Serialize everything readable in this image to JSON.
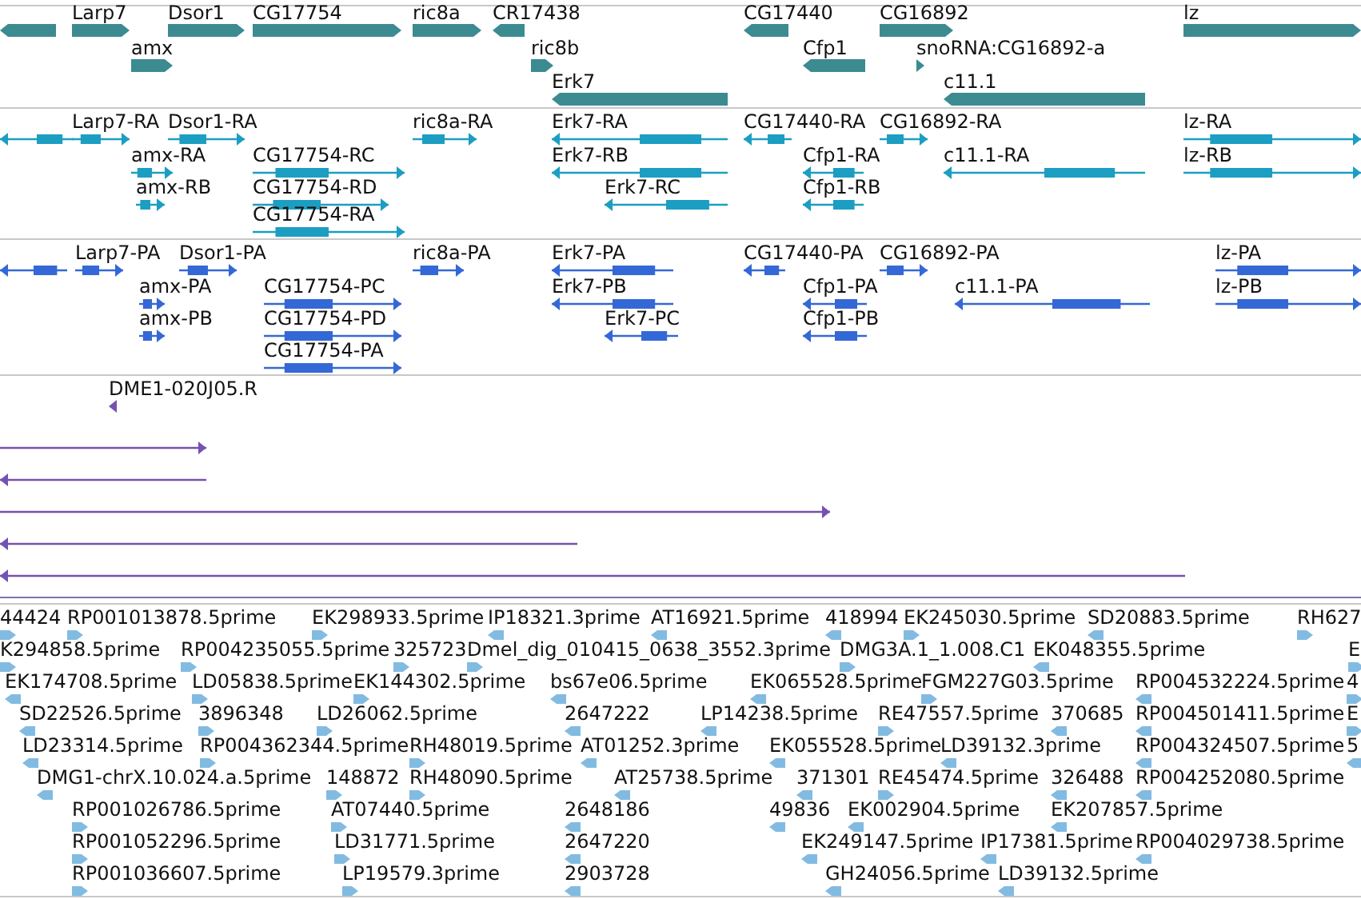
{
  "tracks": [
    {
      "kind": "gene",
      "features": [
        {
          "reverse": true
        },
        {
          "label": "Larp7",
          "reverse": false
        },
        {
          "label": "amx",
          "reverse": false
        },
        {
          "label": "Dsor1",
          "reverse": false
        },
        {
          "label": "CG17754",
          "reverse": false
        },
        {
          "label": "ric8a",
          "reverse": false
        },
        {
          "label": "CR17438",
          "reverse": true
        },
        {
          "label": "ric8b",
          "reverse": false
        },
        {
          "label": "Erk7",
          "reverse": true
        },
        {
          "label": "CG17440",
          "reverse": true
        },
        {
          "label": "Cfp1",
          "reverse": true
        },
        {
          "label": "CG16892",
          "reverse": false
        },
        {
          "label": "snoRNA:CG16892-a",
          "reverse": false
        },
        {
          "label": "c11.1",
          "reverse": true
        },
        {
          "label": "lz",
          "reverse": false
        }
      ]
    },
    {
      "kind": "transcript",
      "features": [
        {
          "reverse": true
        },
        {
          "label": "Larp7-RA",
          "reverse": false
        },
        {
          "label": "Dsor1-RA",
          "reverse": false
        },
        {
          "label": "amx-RA",
          "reverse": false
        },
        {
          "label": "amx-RB",
          "reverse": false
        },
        {
          "label": "CG17754-RC",
          "reverse": false
        },
        {
          "label": "CG17754-RD",
          "reverse": false
        },
        {
          "label": "CG17754-RA",
          "reverse": false
        },
        {
          "label": "ric8a-RA",
          "reverse": false
        },
        {
          "label": "Erk7-RA",
          "reverse": true
        },
        {
          "label": "Erk7-RB",
          "reverse": true
        },
        {
          "label": "Erk7-RC",
          "reverse": true
        },
        {
          "label": "CG17440-RA",
          "reverse": true
        },
        {
          "label": "CG16892-RA",
          "reverse": false
        },
        {
          "label": "Cfp1-RA",
          "reverse": true
        },
        {
          "label": "Cfp1-RB",
          "reverse": true
        },
        {
          "label": "c11.1-RA",
          "reverse": true
        },
        {
          "label": "lz-RA",
          "reverse": false
        },
        {
          "label": "lz-RB",
          "reverse": false
        }
      ]
    },
    {
      "kind": "polypeptide",
      "features": [
        {
          "reverse": true
        },
        {
          "label": "Larp7-PA",
          "reverse": false
        },
        {
          "label": "Dsor1-PA",
          "reverse": false
        },
        {
          "label": "amx-PA",
          "reverse": false
        },
        {
          "label": "amx-PB",
          "reverse": false
        },
        {
          "label": "CG17754-PC",
          "reverse": false
        },
        {
          "label": "CG17754-PD",
          "reverse": false
        },
        {
          "label": "CG17754-PA",
          "reverse": false
        },
        {
          "label": "ric8a-PA",
          "reverse": false
        },
        {
          "label": "Erk7-PA",
          "reverse": true
        },
        {
          "label": "Erk7-PB",
          "reverse": true
        },
        {
          "label": "Erk7-PC",
          "reverse": true
        },
        {
          "label": "CG17440-PA",
          "reverse": true
        },
        {
          "label": "CG16892-PA",
          "reverse": false
        },
        {
          "label": "Cfp1-PA",
          "reverse": true
        },
        {
          "label": "Cfp1-PB",
          "reverse": true
        },
        {
          "label": "c11.1-PA",
          "reverse": true
        },
        {
          "label": "lz-PA",
          "reverse": false
        },
        {
          "label": "lz-PB",
          "reverse": false
        }
      ]
    },
    {
      "kind": "cdna",
      "features": [
        {
          "label": "DME1-020J05.R",
          "reverse": true
        },
        {
          "reverse": false
        },
        {
          "reverse": true
        },
        {
          "reverse": false
        },
        {
          "reverse": true
        },
        {
          "reverse": true
        }
      ]
    },
    {
      "kind": "est",
      "features": [
        {
          "label": "44424",
          "reverse": false
        },
        {
          "label": "RP001013878.5prime",
          "reverse": false
        },
        {
          "label": "EK298933.5prime",
          "reverse": false
        },
        {
          "label": "IP18321.3prime",
          "reverse": true
        },
        {
          "label": "AT16921.5prime",
          "reverse": true
        },
        {
          "label": "418994",
          "reverse": true
        },
        {
          "label": "EK245030.5prime",
          "reverse": false
        },
        {
          "label": "SD20883.5prime",
          "reverse": true
        },
        {
          "label": "RH627",
          "reverse": false
        },
        {
          "label": "K294858.5prime",
          "reverse": false
        },
        {
          "label": "RP004235055.5prime",
          "reverse": false
        },
        {
          "label": "325723",
          "reverse": false
        },
        {
          "label": "Dmel_dig_010415_0638_3552.3prime",
          "reverse": false
        },
        {
          "label": "DMG3A.1_1.008.C1",
          "reverse": false
        },
        {
          "label": "EK048355.5prime",
          "reverse": true
        },
        {
          "label": "E",
          "reverse": false
        },
        {
          "label": "EK174708.5prime",
          "reverse": true
        },
        {
          "label": "LD05838.5prime",
          "reverse": false
        },
        {
          "label": "EK144302.5prime",
          "reverse": false
        },
        {
          "label": "bs67e06.5prime",
          "reverse": true
        },
        {
          "label": "EK065528.5prime",
          "reverse": true
        },
        {
          "label": "FGM227G03.5prime",
          "reverse": false
        },
        {
          "label": "RP004532224.5prime",
          "reverse": true
        },
        {
          "label": "4",
          "reverse": false
        },
        {
          "label": "SD22526.5prime",
          "reverse": true
        },
        {
          "label": "3896348",
          "reverse": false
        },
        {
          "label": "LD26062.5prime",
          "reverse": false
        },
        {
          "label": "2647222",
          "reverse": true
        },
        {
          "label": "LP14238.5prime",
          "reverse": true
        },
        {
          "label": "RE47557.5prime",
          "reverse": false
        },
        {
          "label": "370685",
          "reverse": true
        },
        {
          "label": "RP004501411.5prime",
          "reverse": true
        },
        {
          "label": "E",
          "reverse": false
        },
        {
          "label": "LD23314.5prime",
          "reverse": true
        },
        {
          "label": "RP004362344.5prime",
          "reverse": false
        },
        {
          "label": "RH48019.5prime",
          "reverse": false
        },
        {
          "label": "AT01252.3prime",
          "reverse": true
        },
        {
          "label": "EK055528.5prime",
          "reverse": true
        },
        {
          "label": "LD39132.3prime",
          "reverse": true
        },
        {
          "label": "RP004324507.5prime",
          "reverse": true
        },
        {
          "label": "5",
          "reverse": true
        },
        {
          "label": "DMG1-chrX.10.024.a.5prime",
          "reverse": true
        },
        {
          "label": "148872",
          "reverse": false
        },
        {
          "label": "RH48090.5prime",
          "reverse": false
        },
        {
          "label": "AT25738.5prime",
          "reverse": true
        },
        {
          "label": "371301",
          "reverse": true
        },
        {
          "label": "RE45474.5prime",
          "reverse": false
        },
        {
          "label": "326488",
          "reverse": true
        },
        {
          "label": "RP004252080.5prime",
          "reverse": true
        },
        {
          "label": "RP001026786.5prime",
          "reverse": false
        },
        {
          "label": "AT07440.5prime",
          "reverse": false
        },
        {
          "label": "2648186",
          "reverse": true
        },
        {
          "label": "49836",
          "reverse": true
        },
        {
          "label": "EK002904.5prime",
          "reverse": true
        },
        {
          "label": "EK207857.5prime",
          "reverse": true
        },
        {
          "label": "RP001052296.5prime",
          "reverse": false
        },
        {
          "label": "LD31771.5prime",
          "reverse": false
        },
        {
          "label": "2647220",
          "reverse": true
        },
        {
          "label": "EK249147.5prime",
          "reverse": true
        },
        {
          "label": "IP17381.5prime",
          "reverse": true
        },
        {
          "label": "RP004029738.5prime",
          "reverse": true
        },
        {
          "label": "RP001036607.5prime",
          "reverse": false
        },
        {
          "label": "LP19579.3prime",
          "reverse": false
        },
        {
          "label": "2903728",
          "reverse": true
        },
        {
          "label": "GH24056.5prime",
          "reverse": true
        },
        {
          "label": "LD39132.5prime",
          "reverse": true
        }
      ]
    }
  ]
}
